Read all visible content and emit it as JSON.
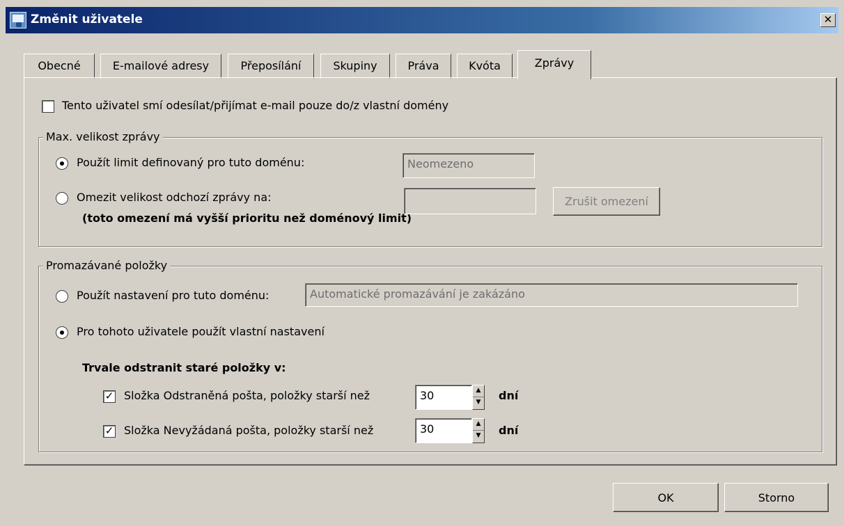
{
  "window": {
    "title": "Změnit uživatele",
    "close_label": "✕",
    "app_icon": "user-config-icon",
    "close_icon": "close-icon"
  },
  "tabs": [
    {
      "label": "Obecné"
    },
    {
      "label": "E-mailové adresy"
    },
    {
      "label": "Přeposílání"
    },
    {
      "label": "Skupiny"
    },
    {
      "label": "Práva"
    },
    {
      "label": "Kvóta"
    },
    {
      "label": "Zprávy"
    }
  ],
  "active_tab": "Zprávy",
  "domain_only": {
    "label": "Tento uživatel smí odesílat/přijímat e-mail pouze do/z vlastní domény",
    "checked": false
  },
  "max_size": {
    "legend": "Max. velikost zprávy",
    "use_domain_label": "Použít limit definovaný pro tuto doménu:",
    "use_domain_selected": true,
    "domain_value": "Neomezeno",
    "limit_label": "Omezit velikost odchozí zprávy na:",
    "limit_note": "(toto omezení má vyšší prioritu než doménový limit)",
    "limit_value": "",
    "clear_button": "Zrušit omezení"
  },
  "cleanup": {
    "legend": "Promazávané položky",
    "use_domain_label": "Použít nastavení pro tuto doménu:",
    "domain_setting": "Automatické promazávání je zakázáno",
    "custom_label": "Pro tohoto uživatele použít vlastní nastavení",
    "custom_selected": true,
    "delete_heading": "Trvale odstranit staré položky v:",
    "deleted": {
      "label": "Složka Odstraněná pošta, položky starší než",
      "checked": true,
      "value": "30",
      "unit": "dní"
    },
    "junk": {
      "label": "Složka Nevyžádaná pošta, položky starší než",
      "checked": true,
      "value": "30",
      "unit": "dní"
    }
  },
  "buttons": {
    "ok": "OK",
    "cancel": "Storno"
  },
  "glyphs": {
    "check": "✓",
    "spin_up": "▲",
    "spin_down": "▼"
  }
}
